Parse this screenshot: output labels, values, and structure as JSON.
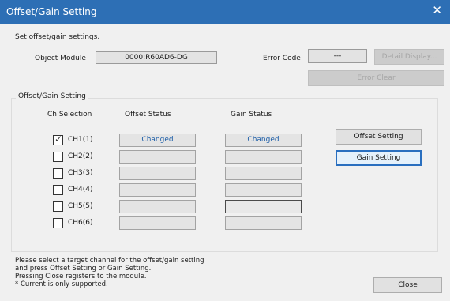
{
  "window": {
    "title": "Offset/Gain Setting"
  },
  "intro": "Set offset/gain settings.",
  "object_module": {
    "label": "Object Module",
    "value": "0000:R60AD6-DG"
  },
  "error_code": {
    "label": "Error Code",
    "value": "---"
  },
  "buttons": {
    "detail_display": "Detail Display...",
    "error_clear": "Error Clear",
    "offset_setting": "Offset Setting",
    "gain_setting": "Gain Setting",
    "close": "Close"
  },
  "group": {
    "title": "Offset/Gain Setting",
    "col_ch": "Ch Selection",
    "col_offset": "Offset Status",
    "col_gain": "Gain Status",
    "channels": [
      {
        "label": "CH1(1)",
        "checked": true,
        "offset": "Changed",
        "gain": "Changed"
      },
      {
        "label": "CH2(2)",
        "checked": false,
        "offset": "",
        "gain": ""
      },
      {
        "label": "CH3(3)",
        "checked": false,
        "offset": "",
        "gain": ""
      },
      {
        "label": "CH4(4)",
        "checked": false,
        "offset": "",
        "gain": ""
      },
      {
        "label": "CH5(5)",
        "checked": false,
        "offset": "",
        "gain": ""
      },
      {
        "label": "CH6(6)",
        "checked": false,
        "offset": "",
        "gain": ""
      }
    ]
  },
  "message": {
    "line1": "Please select a target channel for the offset/gain setting",
    "line2": "and press Offset Setting or Gain Setting.",
    "line3": "Pressing Close registers to the module.",
    "line4": "* Current is only supported."
  }
}
